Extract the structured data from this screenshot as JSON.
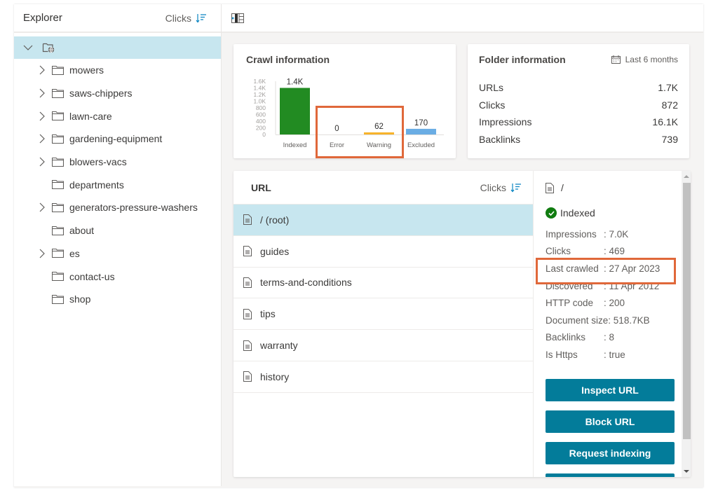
{
  "explorer": {
    "title": "Explorer",
    "sort_label": "Clicks",
    "root_icon": "folder-globe-icon",
    "items": [
      {
        "label": "mowers",
        "expandable": true
      },
      {
        "label": "saws-chippers",
        "expandable": true
      },
      {
        "label": "lawn-care",
        "expandable": true
      },
      {
        "label": "gardening-equipment",
        "expandable": true
      },
      {
        "label": "blowers-vacs",
        "expandable": true
      },
      {
        "label": "departments",
        "expandable": false
      },
      {
        "label": "generators-pressure-washers",
        "expandable": true
      },
      {
        "label": "about",
        "expandable": false
      },
      {
        "label": "es",
        "expandable": true
      },
      {
        "label": "contact-us",
        "expandable": false
      },
      {
        "label": "shop",
        "expandable": false
      }
    ]
  },
  "toolbar": {
    "icon": "collapse-pane-icon"
  },
  "crawl_info": {
    "title": "Crawl information"
  },
  "folder_info": {
    "title": "Folder information",
    "period": "Last 6 months",
    "rows": [
      {
        "label": "URLs",
        "value": "1.7K"
      },
      {
        "label": "Clicks",
        "value": "872"
      },
      {
        "label": "Impressions",
        "value": "16.1K"
      },
      {
        "label": "Backlinks",
        "value": "739"
      }
    ]
  },
  "url_table": {
    "header_label": "URL",
    "sort_label": "Clicks",
    "rows": [
      {
        "label": "/ (root)",
        "selected": true
      },
      {
        "label": "guides",
        "selected": false
      },
      {
        "label": "terms-and-conditions",
        "selected": false
      },
      {
        "label": "tips",
        "selected": false
      },
      {
        "label": "warranty",
        "selected": false
      },
      {
        "label": "history",
        "selected": false
      }
    ]
  },
  "detail": {
    "path": "/",
    "status": "Indexed",
    "status_color": "#107c10",
    "properties": [
      {
        "key": "Impressions",
        "value": ": 7.0K"
      },
      {
        "key": "Clicks",
        "value": ": 469"
      },
      {
        "key": "Last crawled",
        "value": ": 27 Apr 2023"
      },
      {
        "key": "Discovered",
        "value": ": 11 Apr 2012"
      },
      {
        "key": "HTTP code",
        "value": ": 200"
      },
      {
        "key": "Document size",
        "value": ": 518.7KB"
      },
      {
        "key": "Backlinks",
        "value": ": 8"
      },
      {
        "key": "Is Https",
        "value": ": true"
      }
    ],
    "buttons": {
      "inspect": "Inspect URL",
      "block": "Block URL",
      "request": "Request indexing"
    },
    "button_color": "#037c9a"
  },
  "chart_data": {
    "type": "bar",
    "title": "Crawl information",
    "categories": [
      "Indexed",
      "Error",
      "Warning",
      "Excluded"
    ],
    "values": [
      1400,
      0,
      62,
      170
    ],
    "data_labels": [
      "1.4K",
      "0",
      "62",
      "170"
    ],
    "colors": [
      "#228b22",
      "#c4c4c4",
      "#f7b32b",
      "#6aade4"
    ],
    "yticks": [
      "0",
      "200",
      "400",
      "600",
      "800",
      "1.0K",
      "1.2K",
      "1.4K",
      "1.6K"
    ],
    "ylim": [
      0,
      1600
    ],
    "xlabel": "",
    "ylabel": "",
    "grid": false,
    "legend": "none"
  }
}
